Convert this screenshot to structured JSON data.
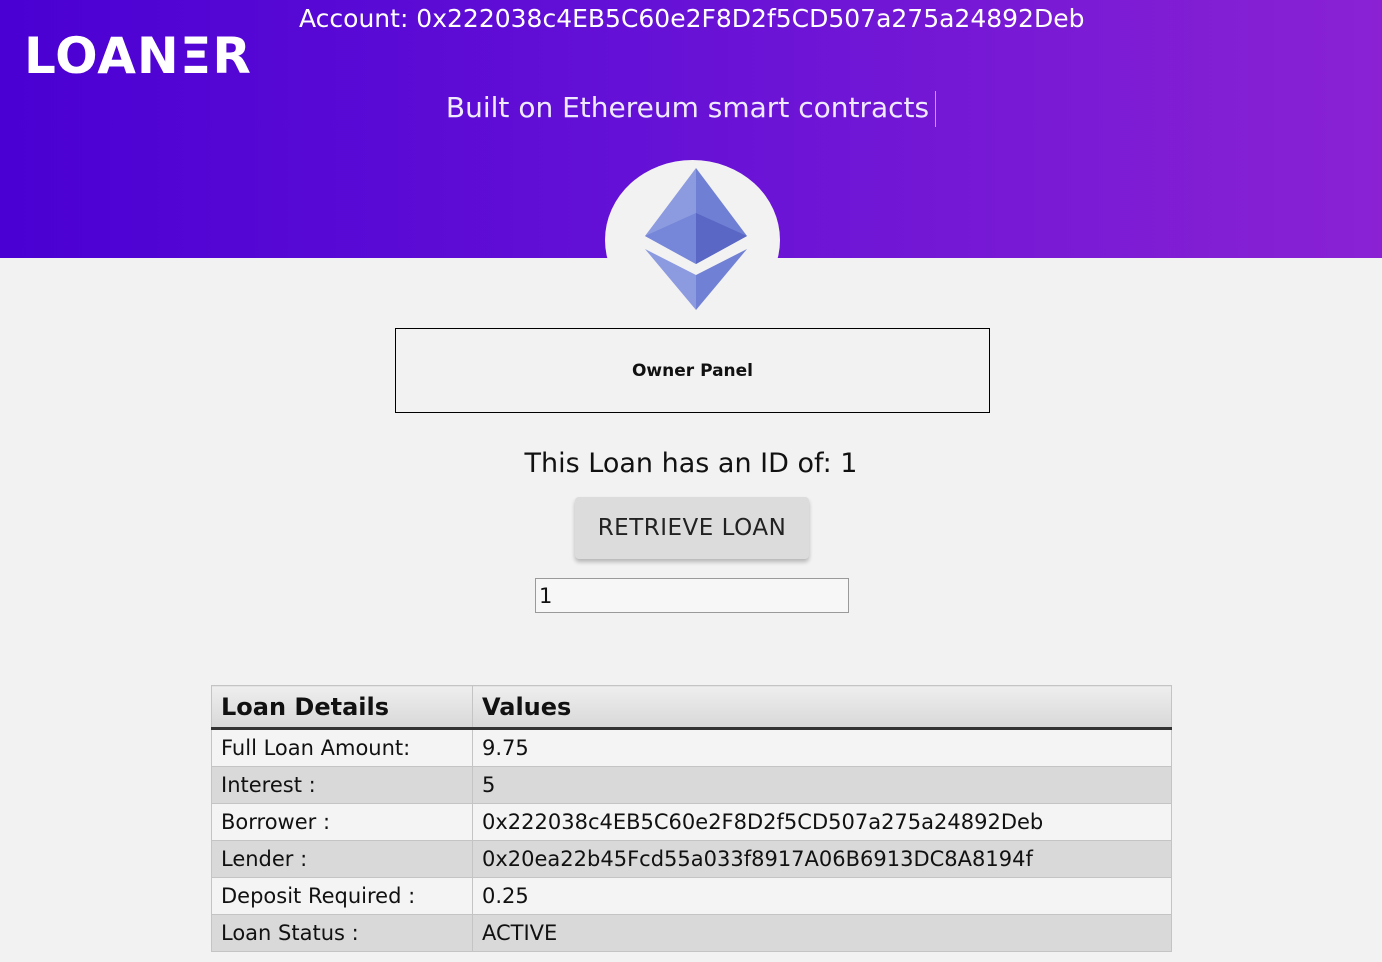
{
  "header": {
    "logo_text": "LOANΞR",
    "account_label": "Account: 0x222038c4EB5C60e2F8D2f5CD507a275a24892Deb",
    "tagline": "Built on Ethereum smart contracts",
    "logo_icon": "ethereum-logo-icon"
  },
  "owner_panel": {
    "label": "Owner Panel"
  },
  "loan": {
    "id_line": "This Loan has an ID of: 1",
    "retrieve_button": "RETRIEVE LOAN",
    "input_value": "1"
  },
  "table": {
    "headers": [
      "Loan Details",
      "Values"
    ],
    "rows": [
      {
        "label": "Full Loan Amount:",
        "value": "9.75"
      },
      {
        "label": "Interest :",
        "value": "5"
      },
      {
        "label": "Borrower :",
        "value": "0x222038c4EB5C60e2F8D2f5CD507a275a24892Deb"
      },
      {
        "label": "Lender :",
        "value": "0x20ea22b45Fcd55a033f8917A06B6913DC8A8194f"
      },
      {
        "label": "Deposit Required :",
        "value": "0.25"
      },
      {
        "label": "Loan Status :",
        "value": "ACTIVE"
      }
    ]
  },
  "colors": {
    "header_gradient_start": "#4a00d3",
    "header_gradient_end": "#8a22d4",
    "eth_logo_light": "#8c9ae0",
    "eth_logo_dark": "#5a67c4"
  }
}
